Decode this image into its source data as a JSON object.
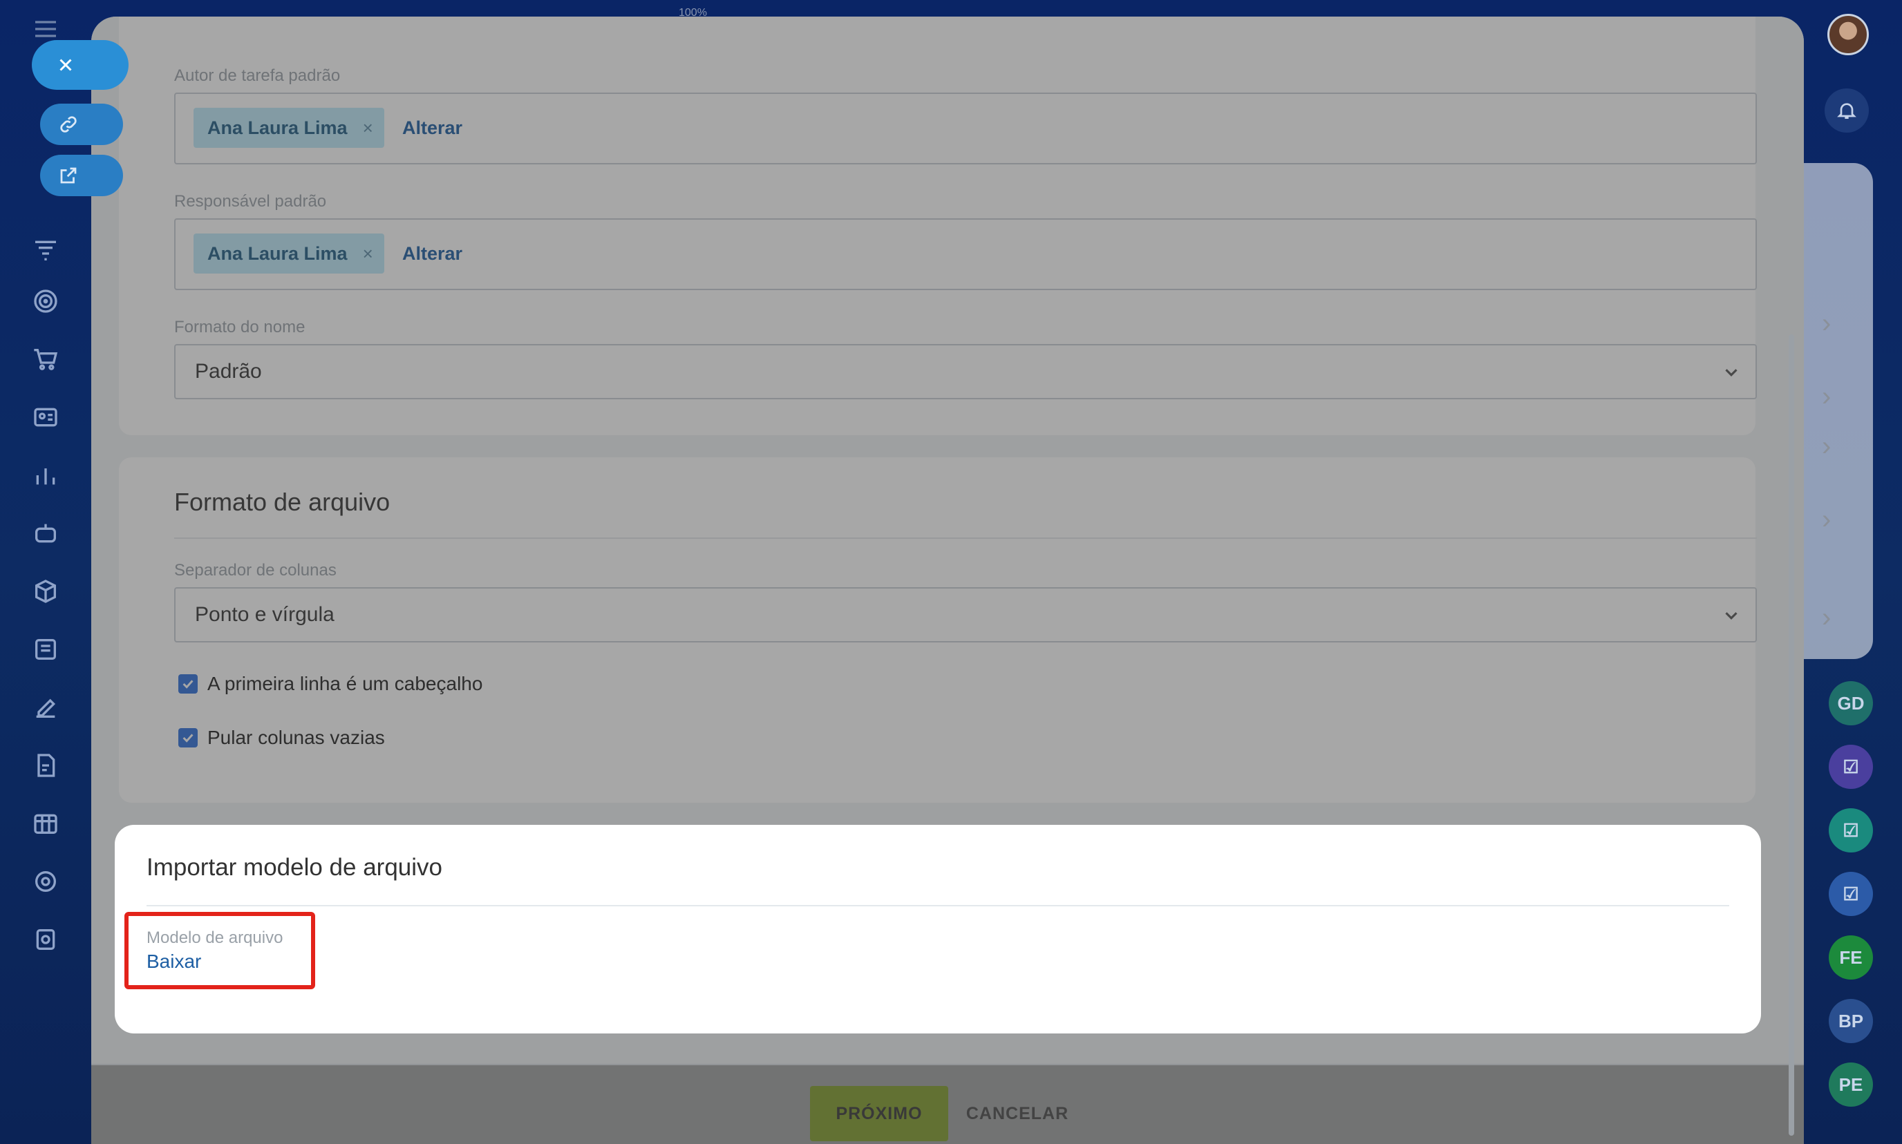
{
  "background": {
    "zoom_label": "100%",
    "right_rail_badges": [
      "GD",
      "FE",
      "BP",
      "PE"
    ]
  },
  "default_author": {
    "label": "Autor de tarefa padrão",
    "tag": "Ana Laura Lima",
    "tag_remove": "×",
    "change": "Alterar"
  },
  "default_responsible": {
    "label": "Responsável padrão",
    "tag": "Ana Laura Lima",
    "tag_remove": "×",
    "change": "Alterar"
  },
  "name_format": {
    "label": "Formato do nome",
    "value": "Padrão"
  },
  "file_format": {
    "title": "Formato de arquivo",
    "separator_label": "Separador de colunas",
    "separator_value": "Ponto e vírgula",
    "first_row_header": "A primeira linha é um cabeçalho",
    "first_row_header_checked": true,
    "skip_empty_columns": "Pular colunas vazias",
    "skip_empty_columns_checked": true
  },
  "import_template": {
    "title": "Importar modelo de arquivo",
    "field_label": "Modelo de arquivo",
    "download_link": "Baixar"
  },
  "footer": {
    "next_button": "PRÓXIMO",
    "cancel_button": "CANCELAR"
  },
  "colors": {
    "accent_green": "#bbed21",
    "link_blue": "#1d5ea3",
    "tag_bg": "#bde9f9",
    "highlight_red": "#e3231a",
    "checkbox_blue": "#2f6fdb"
  }
}
